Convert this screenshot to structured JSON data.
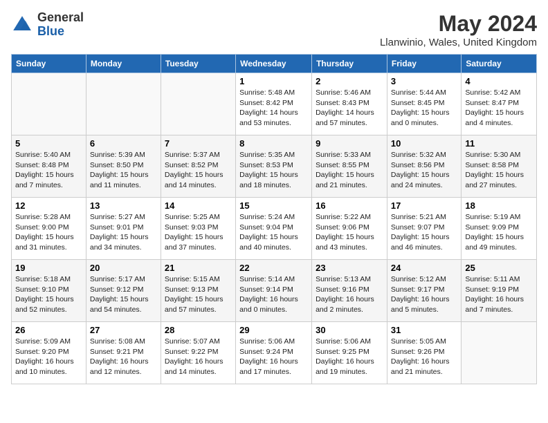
{
  "logo": {
    "general": "General",
    "blue": "Blue"
  },
  "header": {
    "month_year": "May 2024",
    "location": "Llanwinio, Wales, United Kingdom"
  },
  "days_of_week": [
    "Sunday",
    "Monday",
    "Tuesday",
    "Wednesday",
    "Thursday",
    "Friday",
    "Saturday"
  ],
  "weeks": [
    [
      {
        "day": "",
        "info": ""
      },
      {
        "day": "",
        "info": ""
      },
      {
        "day": "",
        "info": ""
      },
      {
        "day": "1",
        "info": "Sunrise: 5:48 AM\nSunset: 8:42 PM\nDaylight: 14 hours and 53 minutes."
      },
      {
        "day": "2",
        "info": "Sunrise: 5:46 AM\nSunset: 8:43 PM\nDaylight: 14 hours and 57 minutes."
      },
      {
        "day": "3",
        "info": "Sunrise: 5:44 AM\nSunset: 8:45 PM\nDaylight: 15 hours and 0 minutes."
      },
      {
        "day": "4",
        "info": "Sunrise: 5:42 AM\nSunset: 8:47 PM\nDaylight: 15 hours and 4 minutes."
      }
    ],
    [
      {
        "day": "5",
        "info": "Sunrise: 5:40 AM\nSunset: 8:48 PM\nDaylight: 15 hours and 7 minutes."
      },
      {
        "day": "6",
        "info": "Sunrise: 5:39 AM\nSunset: 8:50 PM\nDaylight: 15 hours and 11 minutes."
      },
      {
        "day": "7",
        "info": "Sunrise: 5:37 AM\nSunset: 8:52 PM\nDaylight: 15 hours and 14 minutes."
      },
      {
        "day": "8",
        "info": "Sunrise: 5:35 AM\nSunset: 8:53 PM\nDaylight: 15 hours and 18 minutes."
      },
      {
        "day": "9",
        "info": "Sunrise: 5:33 AM\nSunset: 8:55 PM\nDaylight: 15 hours and 21 minutes."
      },
      {
        "day": "10",
        "info": "Sunrise: 5:32 AM\nSunset: 8:56 PM\nDaylight: 15 hours and 24 minutes."
      },
      {
        "day": "11",
        "info": "Sunrise: 5:30 AM\nSunset: 8:58 PM\nDaylight: 15 hours and 27 minutes."
      }
    ],
    [
      {
        "day": "12",
        "info": "Sunrise: 5:28 AM\nSunset: 9:00 PM\nDaylight: 15 hours and 31 minutes."
      },
      {
        "day": "13",
        "info": "Sunrise: 5:27 AM\nSunset: 9:01 PM\nDaylight: 15 hours and 34 minutes."
      },
      {
        "day": "14",
        "info": "Sunrise: 5:25 AM\nSunset: 9:03 PM\nDaylight: 15 hours and 37 minutes."
      },
      {
        "day": "15",
        "info": "Sunrise: 5:24 AM\nSunset: 9:04 PM\nDaylight: 15 hours and 40 minutes."
      },
      {
        "day": "16",
        "info": "Sunrise: 5:22 AM\nSunset: 9:06 PM\nDaylight: 15 hours and 43 minutes."
      },
      {
        "day": "17",
        "info": "Sunrise: 5:21 AM\nSunset: 9:07 PM\nDaylight: 15 hours and 46 minutes."
      },
      {
        "day": "18",
        "info": "Sunrise: 5:19 AM\nSunset: 9:09 PM\nDaylight: 15 hours and 49 minutes."
      }
    ],
    [
      {
        "day": "19",
        "info": "Sunrise: 5:18 AM\nSunset: 9:10 PM\nDaylight: 15 hours and 52 minutes."
      },
      {
        "day": "20",
        "info": "Sunrise: 5:17 AM\nSunset: 9:12 PM\nDaylight: 15 hours and 54 minutes."
      },
      {
        "day": "21",
        "info": "Sunrise: 5:15 AM\nSunset: 9:13 PM\nDaylight: 15 hours and 57 minutes."
      },
      {
        "day": "22",
        "info": "Sunrise: 5:14 AM\nSunset: 9:14 PM\nDaylight: 16 hours and 0 minutes."
      },
      {
        "day": "23",
        "info": "Sunrise: 5:13 AM\nSunset: 9:16 PM\nDaylight: 16 hours and 2 minutes."
      },
      {
        "day": "24",
        "info": "Sunrise: 5:12 AM\nSunset: 9:17 PM\nDaylight: 16 hours and 5 minutes."
      },
      {
        "day": "25",
        "info": "Sunrise: 5:11 AM\nSunset: 9:19 PM\nDaylight: 16 hours and 7 minutes."
      }
    ],
    [
      {
        "day": "26",
        "info": "Sunrise: 5:09 AM\nSunset: 9:20 PM\nDaylight: 16 hours and 10 minutes."
      },
      {
        "day": "27",
        "info": "Sunrise: 5:08 AM\nSunset: 9:21 PM\nDaylight: 16 hours and 12 minutes."
      },
      {
        "day": "28",
        "info": "Sunrise: 5:07 AM\nSunset: 9:22 PM\nDaylight: 16 hours and 14 minutes."
      },
      {
        "day": "29",
        "info": "Sunrise: 5:06 AM\nSunset: 9:24 PM\nDaylight: 16 hours and 17 minutes."
      },
      {
        "day": "30",
        "info": "Sunrise: 5:06 AM\nSunset: 9:25 PM\nDaylight: 16 hours and 19 minutes."
      },
      {
        "day": "31",
        "info": "Sunrise: 5:05 AM\nSunset: 9:26 PM\nDaylight: 16 hours and 21 minutes."
      },
      {
        "day": "",
        "info": ""
      }
    ]
  ]
}
